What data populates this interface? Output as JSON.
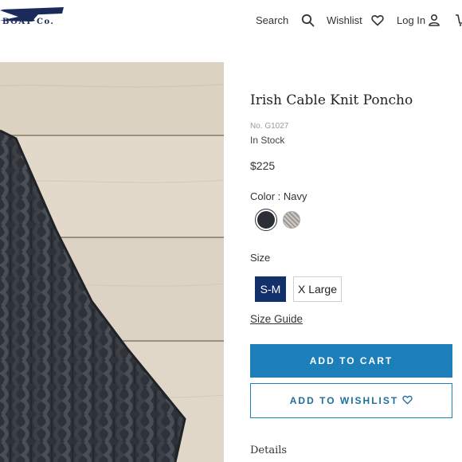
{
  "header": {
    "logo_text": "BOAT Co.",
    "nav": {
      "search_label": "Search",
      "wishlist_label": "Wishlist",
      "login_label": "Log In"
    }
  },
  "product": {
    "image_icon": "product-photo",
    "title": "Irish Cable Knit Poncho",
    "sku": "No. G1027",
    "stock": "In Stock",
    "price": "$225",
    "color_label": "Color : Navy",
    "colors": [
      {
        "name": "navy",
        "hex": "#2b2e36",
        "selected": true
      },
      {
        "name": "grey",
        "hex": "#bdb8b3",
        "selected": false
      }
    ],
    "size_label": "Size",
    "sizes": [
      {
        "label": "S-M",
        "selected": true
      },
      {
        "label": "X Large",
        "selected": false
      }
    ],
    "size_guide": "Size Guide",
    "add_to_cart": "ADD TO CART",
    "add_to_wishlist": "ADD TO WISHLIST",
    "details_label": "Details"
  },
  "colors": {
    "brand_navy": "#1b2a5b",
    "cta_blue": "#1d7fb9",
    "selected_size_bg": "#14306b"
  }
}
